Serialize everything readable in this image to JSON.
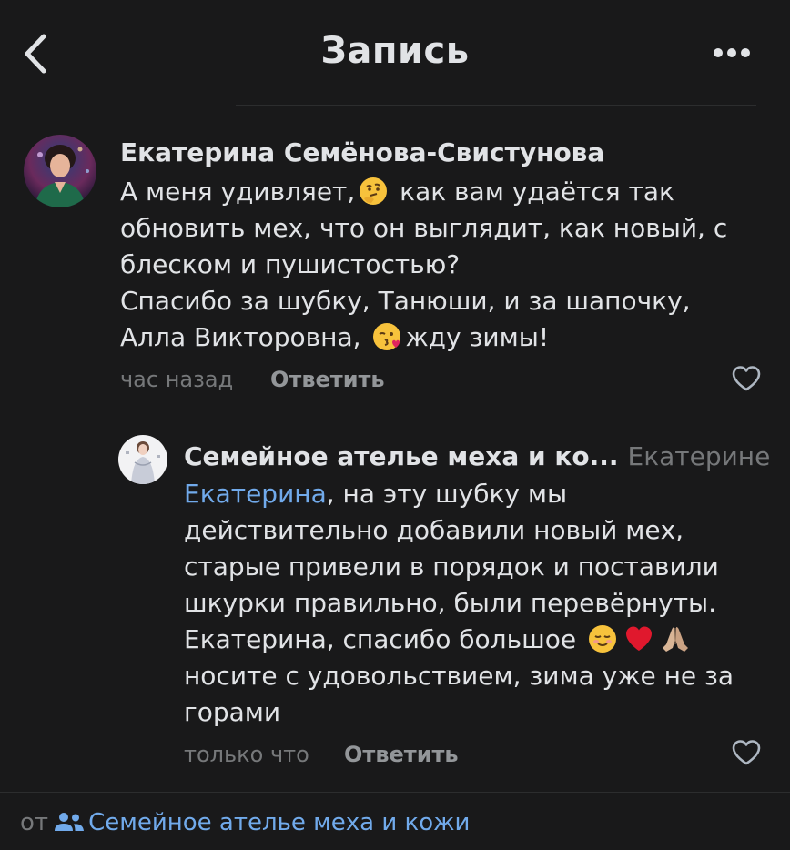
{
  "header": {
    "title": "Запись",
    "back_icon": "chevron-left-icon",
    "more_icon": "more-horizontal-icon"
  },
  "comment": {
    "author": "Екатерина Семёнова-Свистунова",
    "text_lines": [
      [
        "А меня удивляет,",
        "как вам удаётся так"
      ],
      [
        "обновить мех, что он выглядит, как новый, с"
      ],
      [
        "блеском и пушистостью?"
      ],
      [
        "Спасибо за шубку, Танюши, и за шапочку,"
      ],
      [
        "Алла Викторовна,",
        "жду зимы!"
      ]
    ],
    "emojis": [
      "thinking-face",
      "face-blowing-kiss"
    ],
    "time": "час назад",
    "reply_label": "Ответить",
    "like_icon": "heart-outline-icon"
  },
  "reply": {
    "author": "Семейное ателье меха и ко...",
    "reply_to": "Екатерине",
    "mention": "Екатерина",
    "text_lines": [
      ", на эту шубку мы",
      "действительно добавили новый мех,",
      "старые привели в порядок и поставили",
      "шкурки правильно, были перевёрнуты.",
      "Екатерина, спасибо большое",
      "носите с удовольствием, зима уже не за",
      "горами"
    ],
    "emojis": [
      "smiling-face",
      "red-heart",
      "folded-hands"
    ],
    "time": "только что",
    "reply_label": "Ответить",
    "like_icon": "heart-outline-icon"
  },
  "footer": {
    "prefix": "от",
    "group_name": "Семейное ателье меха и кожи",
    "group_icon": "users-icon"
  },
  "colors": {
    "background": "#19191a",
    "text": "#e1e3e6",
    "secondary": "#76787a",
    "link": "#71aaeb"
  }
}
